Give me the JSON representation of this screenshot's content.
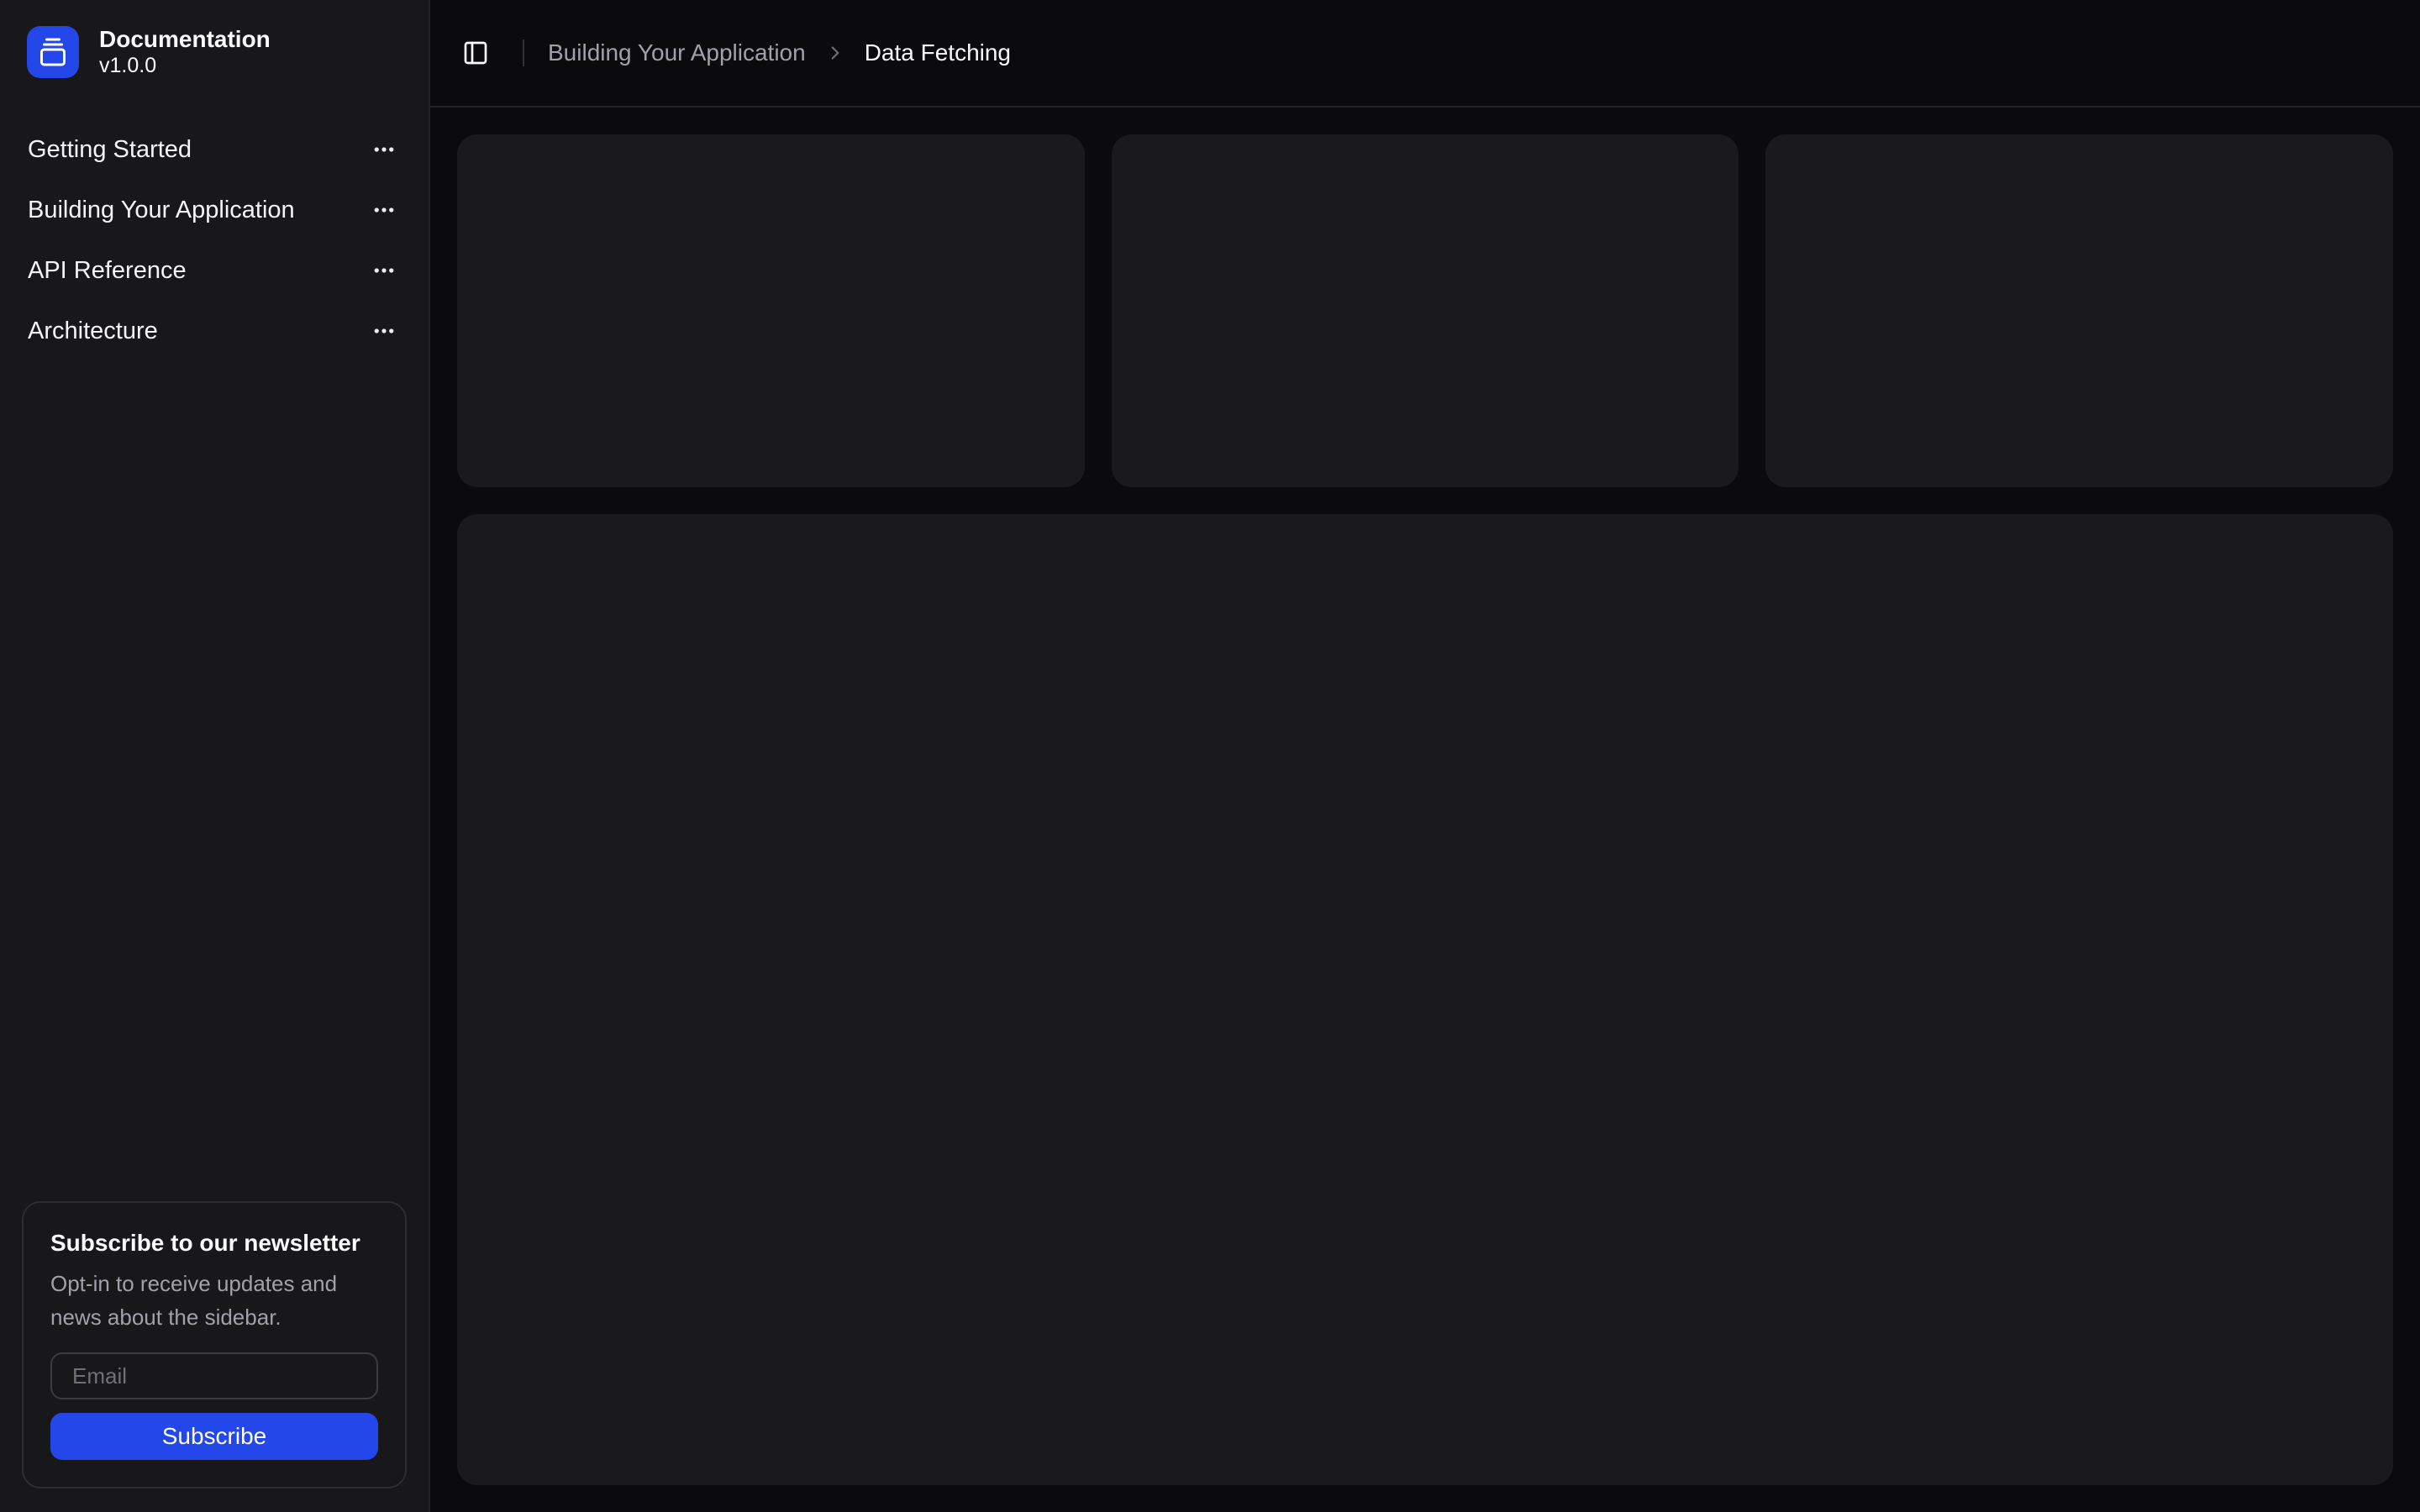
{
  "colors": {
    "primary": "#2347e8",
    "sidebar-bg": "#18181b",
    "content-bg": "#0b0b0d",
    "card-bg": "#1a1a1d",
    "border": "#232327",
    "text-primary": "#fafafa",
    "text-muted": "#a1a1aa"
  },
  "app": {
    "title": "Documentation",
    "version": "v1.0.0"
  },
  "icons": {
    "logo": "gallery-vertical-end-icon",
    "item_menu": "ellipsis-icon",
    "sidebar_toggle": "panel-left-icon",
    "breadcrumb_separator": "chevron-right-icon"
  },
  "sidebar": {
    "items": [
      {
        "label": "Getting Started"
      },
      {
        "label": "Building Your Application"
      },
      {
        "label": "API Reference"
      },
      {
        "label": "Architecture"
      }
    ],
    "newsletter": {
      "title": "Subscribe to our newsletter",
      "description": "Opt-in to receive updates and news about the sidebar.",
      "email_placeholder": "Email",
      "email_value": "",
      "subscribe_label": "Subscribe"
    }
  },
  "header": {
    "breadcrumb": {
      "parent": "Building Your Application",
      "current": "Data Fetching"
    }
  },
  "content": {
    "placeholder_card_count": 3
  }
}
